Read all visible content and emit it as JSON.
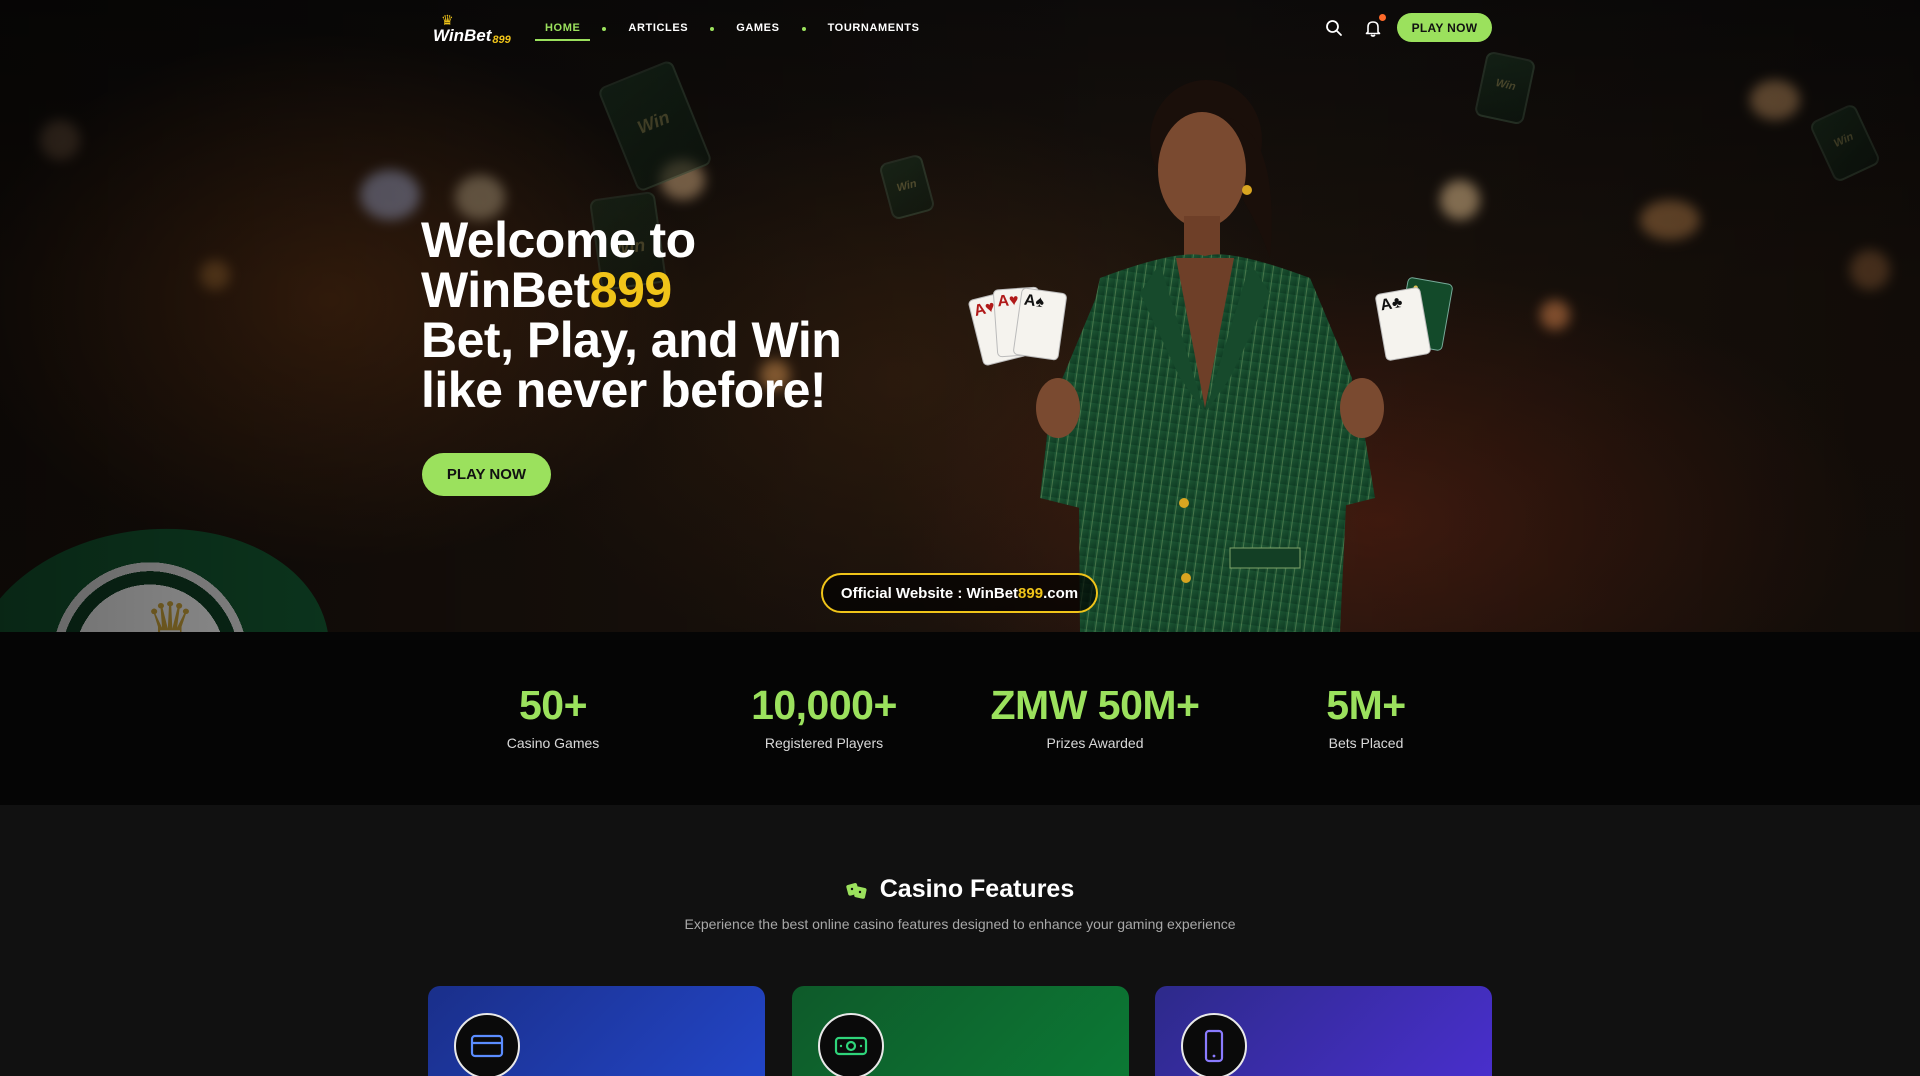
{
  "brand": {
    "name": "WinBet",
    "suffix": "899",
    "accent": "#f0c419",
    "green": "#9be15d"
  },
  "nav": {
    "items": [
      {
        "label": "HOME",
        "active": true
      },
      {
        "label": "ARTICLES",
        "active": false
      },
      {
        "label": "GAMES",
        "active": false
      },
      {
        "label": "TOURNAMENTS",
        "active": false
      }
    ],
    "search_icon": "search-icon",
    "bell_icon": "bell-icon",
    "play_label": "PLAY NOW"
  },
  "hero": {
    "line1": "Welcome to",
    "line2_main": "WinBet",
    "line2_accent": "899",
    "line3": "Bet, Play, and Win",
    "line4": "like never before!",
    "cta_label": "PLAY NOW",
    "official_prefix": "Official Website : WinBet",
    "official_accent": "899",
    "official_suffix": ".com"
  },
  "stats": [
    {
      "value": "50+",
      "label": "Casino Games"
    },
    {
      "value": "10,000+",
      "label": "Registered Players"
    },
    {
      "value": "ZMW 50M+",
      "label": "Prizes Awarded"
    },
    {
      "value": "5M+",
      "label": "Bets Placed"
    }
  ],
  "features": {
    "title": "Casino Features",
    "subtitle": "Experience the best online casino features designed to enhance your gaming experience",
    "cards": [
      {
        "icon": "credit-card-icon",
        "color_from": "#1a2f8a",
        "color_to": "#2346c9"
      },
      {
        "icon": "cash-icon",
        "color_from": "#0e5a2a",
        "color_to": "#0c7a35"
      },
      {
        "icon": "mobile-phone-icon",
        "color_from": "#2d2a8a",
        "color_to": "#4a2fcf"
      }
    ]
  }
}
